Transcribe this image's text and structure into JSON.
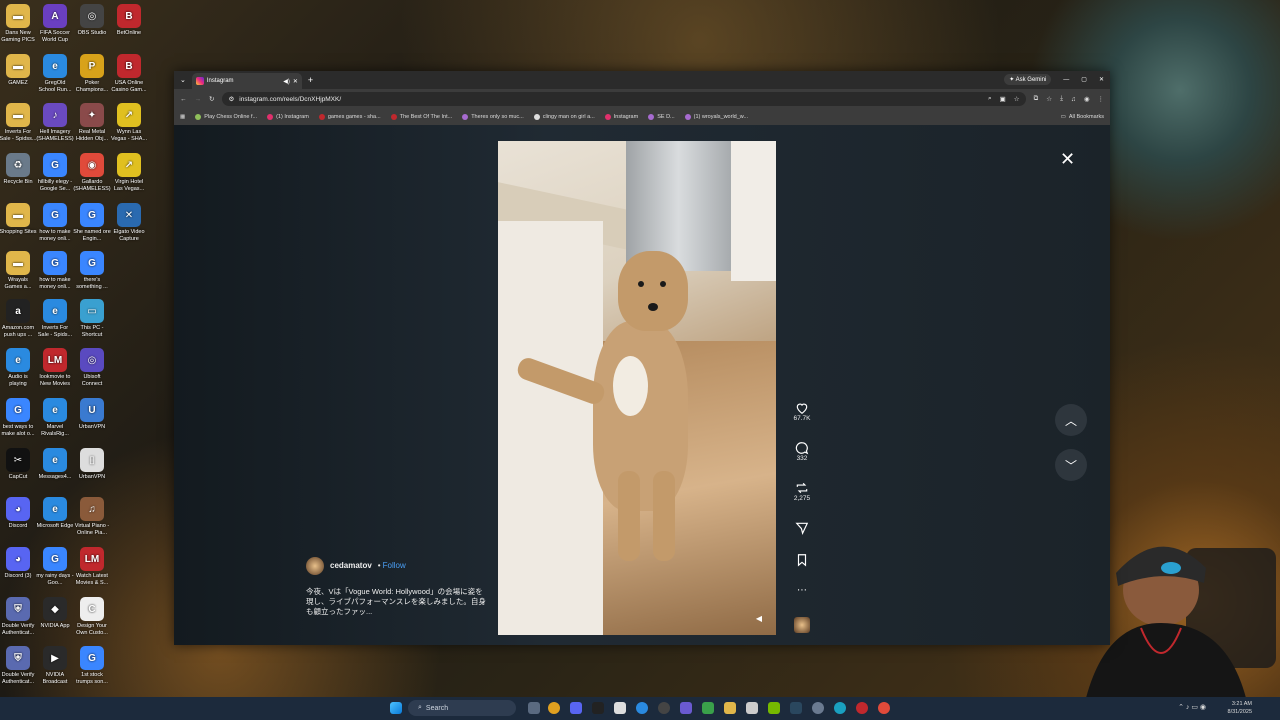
{
  "desktop_icons": [
    {
      "label": "Dans New Gaming PICS",
      "color": "#e0b64a",
      "glyph": "▬"
    },
    {
      "label": "FIFA Soccer World Cup",
      "color": "#6a3fc0",
      "glyph": "A"
    },
    {
      "label": "OBS Studio",
      "color": "#444",
      "glyph": "◎"
    },
    {
      "label": "BetOnline",
      "color": "#c0282d",
      "glyph": "B"
    },
    {
      "label": "GAMEZ",
      "color": "#e0b64a",
      "glyph": "▬"
    },
    {
      "label": "GregOld School Run...",
      "color": "#2a8ae0",
      "glyph": "e"
    },
    {
      "label": "Poker Champions...",
      "color": "#d8a21a",
      "glyph": "P"
    },
    {
      "label": "USA Online Casino Gam...",
      "color": "#c0282d",
      "glyph": "B"
    },
    {
      "label": "Inverts For Sale - Spidss...",
      "color": "#e0b64a",
      "glyph": "▬"
    },
    {
      "label": "Hell Imagery (SHAMELESS)",
      "color": "#6a4ac0",
      "glyph": "♪"
    },
    {
      "label": "Real Metal Hidden Obj...",
      "color": "#8a4a4a",
      "glyph": "✦"
    },
    {
      "label": "Wynn Las Vegas - SHA...",
      "color": "#e0c020",
      "glyph": "↗"
    },
    {
      "label": "Recycle Bin",
      "color": "#6a7a8a",
      "glyph": "♻"
    },
    {
      "label": "hillbilly elegy - Google Se...",
      "color": "#3a86ff",
      "glyph": "G"
    },
    {
      "label": "Gallardo (SHAMELESS)",
      "color": "#e04a3a",
      "glyph": "◉"
    },
    {
      "label": "Virgin Hotel Las Vegas...",
      "color": "#e0c020",
      "glyph": "↗"
    },
    {
      "label": "Shopping Sites",
      "color": "#e0b64a",
      "glyph": "▬"
    },
    {
      "label": "how to make money onli...",
      "color": "#3a86ff",
      "glyph": "G"
    },
    {
      "label": "She named ore Engin...",
      "color": "#3a86ff",
      "glyph": "G"
    },
    {
      "label": "Elgato Video Capture",
      "color": "#2a6ab0",
      "glyph": "✕"
    },
    {
      "label": "Wrayals Games a...",
      "color": "#e0b64a",
      "glyph": "▬"
    },
    {
      "label": "how to make money onli...",
      "color": "#3a86ff",
      "glyph": "G"
    },
    {
      "label": "there's something ...",
      "color": "#3a86ff",
      "glyph": "G"
    },
    {
      "label": "Amazon.com push ups ...",
      "color": "#222",
      "glyph": "a"
    },
    {
      "label": "Inverts For Sale - Spids...",
      "color": "#2a8ae0",
      "glyph": "e"
    },
    {
      "label": "This PC - Shortcut",
      "color": "#3aa0d0",
      "glyph": "▭"
    },
    {
      "label": "Audio is playing",
      "color": "#2a8ae0",
      "glyph": "e"
    },
    {
      "label": "lookmovie to New Movies",
      "color": "#c0282d",
      "glyph": "LM"
    },
    {
      "label": "Ubisoft Connect",
      "color": "#5a4ac0",
      "glyph": "◎"
    },
    {
      "label": "best ways to make alot o...",
      "color": "#3a86ff",
      "glyph": "G"
    },
    {
      "label": "Marvel RivalsRig...",
      "color": "#2a8ae0",
      "glyph": "e"
    },
    {
      "label": "UrbanVPN",
      "color": "#3a7ad0",
      "glyph": "U"
    },
    {
      "label": "CapCut",
      "color": "#111",
      "glyph": "✂"
    },
    {
      "label": "Messages4...",
      "color": "#2a8ae0",
      "glyph": "e"
    },
    {
      "label": "UrbanVPN",
      "color": "#ddd",
      "glyph": "▯"
    },
    {
      "label": "Discord",
      "color": "#5865f2",
      "glyph": "◕"
    },
    {
      "label": "Microsoft Edge",
      "color": "#2a8ae0",
      "glyph": "e"
    },
    {
      "label": "Virtual Piano - Online Pia...",
      "color": "#8a5a3a",
      "glyph": "♫"
    },
    {
      "label": "Discord (3)",
      "color": "#5865f2",
      "glyph": "◕"
    },
    {
      "label": "my rainy days - Goo...",
      "color": "#3a86ff",
      "glyph": "G"
    },
    {
      "label": "Watch Latest Movies & S...",
      "color": "#c0282d",
      "glyph": "LM"
    },
    {
      "label": "Double Verify Authenticat...",
      "color": "#5a6ab0",
      "glyph": "⛨"
    },
    {
      "label": "NVIDIA App",
      "color": "#2a2a2a",
      "glyph": "◆"
    },
    {
      "label": "Design Your Own Custo...",
      "color": "#eee",
      "glyph": "C"
    },
    {
      "label": "Double Verify Authenticat...",
      "color": "#5a6ab0",
      "glyph": "⛨"
    },
    {
      "label": "NVIDIA Broadcast",
      "color": "#2a2a2a",
      "glyph": "▶"
    },
    {
      "label": "1st stock trumps son...",
      "color": "#3a86ff",
      "glyph": "G"
    }
  ],
  "browser": {
    "tab_title": "Instagram",
    "ask_gemini": "Ask Gemini",
    "url": "instagram.com/reels/DcnXHjpMXK/",
    "bookmarks": [
      {
        "label": "Play Chess Online f...",
        "color": "#8fbf5a"
      },
      {
        "label": "(1) Instagram",
        "color": "#e1306c"
      },
      {
        "label": "games games - sha...",
        "color": "#c0282d"
      },
      {
        "label": "The Best Of The Int...",
        "color": "#c0282d"
      },
      {
        "label": "Theres only so muc...",
        "color": "#a76bd0"
      },
      {
        "label": "clingy man on girl a...",
        "color": "#ddd"
      },
      {
        "label": "Instagram",
        "color": "#e1306c"
      },
      {
        "label": "SE D...",
        "color": "#a76bd0"
      },
      {
        "label": "(1) wroyals_world_w...",
        "color": "#a76bd0"
      }
    ],
    "all_bookmarks": "All Bookmarks"
  },
  "reel": {
    "author": "cedamatov",
    "follow": "Follow",
    "separator": "•",
    "caption": "今夜、Vは「Vogue World: Hollywood」の会場に姿を現し、ライブパフォーマンスレを楽しみました。自身も顧立ったファッ...",
    "likes": "67.7K",
    "comments": "332",
    "reposts": "2,275"
  },
  "taskbar": {
    "search_placeholder": "Search",
    "time": "3:21 AM",
    "date": "8/31/2025"
  }
}
